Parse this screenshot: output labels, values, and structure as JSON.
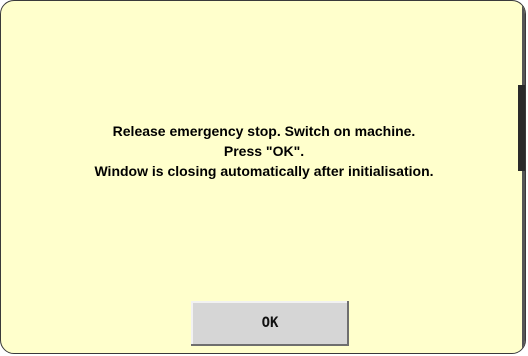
{
  "dialog": {
    "message_lines": [
      "Release emergency stop. Switch on machine.",
      "Press \"OK\".",
      "Window is closing automatically after initialisation."
    ],
    "ok_label": "OK"
  },
  "colors": {
    "dialog_background": "#ffffcc",
    "button_background": "#d6d6d6",
    "border": "#3a3a3a"
  }
}
